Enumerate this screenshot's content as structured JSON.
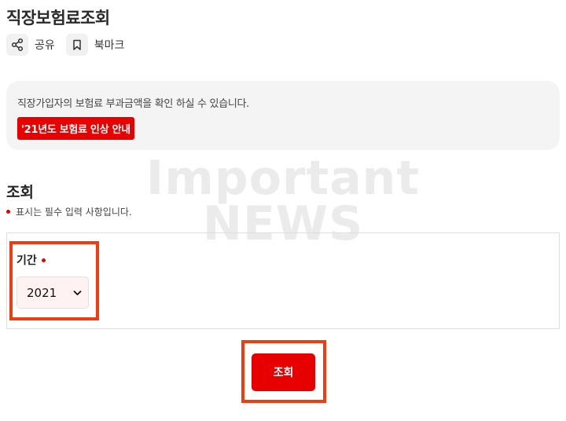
{
  "page": {
    "title": "직장보험료조회"
  },
  "utilities": {
    "share_label": "공유",
    "bookmark_label": "북마크"
  },
  "notice": {
    "text": "직장가입자의 보험료 부과금액을 확인 하실 수 있습니다.",
    "link_label": "'21년도 보험료 인상 안내"
  },
  "watermark": {
    "line1": "Important",
    "line2": "NEWS"
  },
  "section": {
    "title": "조회",
    "required_note": "표시는 필수 입력 사항입니다."
  },
  "form": {
    "period_label": "기간",
    "period_value": "2021"
  },
  "actions": {
    "submit_label": "조회"
  },
  "colors": {
    "accent": "#e60000",
    "highlight": "#f03c10"
  }
}
